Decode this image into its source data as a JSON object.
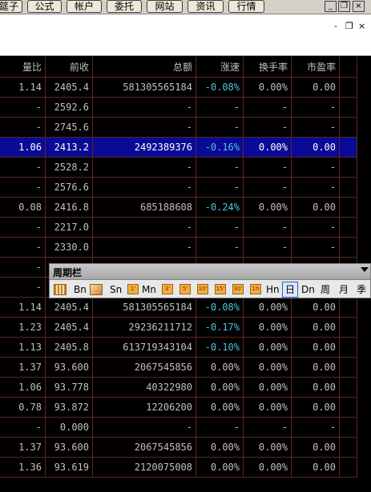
{
  "menubar": {
    "items": [
      "筵子",
      "公式",
      "帐户",
      "委托",
      "网站",
      "资讯",
      "行情"
    ],
    "window_controls": [
      "_",
      "❐",
      "×"
    ]
  },
  "subwindow": {
    "controls": [
      "-",
      "❐",
      "×"
    ]
  },
  "table": {
    "headers": [
      "量比",
      "前收",
      "总额",
      "涨速",
      "换手率",
      "市盈率"
    ],
    "selected_row": 3,
    "rows": [
      [
        "1.14",
        "2405.4",
        "581305565184",
        "-0.08%",
        "0.00%",
        "0.00"
      ],
      [
        "-",
        "2592.6",
        "-",
        "-",
        "-",
        "-"
      ],
      [
        "-",
        "2745.6",
        "-",
        "-",
        "-",
        "-"
      ],
      [
        "1.06",
        "2413.2",
        "2492389376",
        "-0.16%",
        "0.00%",
        "0.00"
      ],
      [
        "-",
        "2528.2",
        "-",
        "-",
        "-",
        "-"
      ],
      [
        "-",
        "2576.6",
        "-",
        "-",
        "-",
        "-"
      ],
      [
        "0.08",
        "2416.8",
        "685188608",
        "-0.24%",
        "0.00%",
        "0.00"
      ],
      [
        "-",
        "2217.0",
        "-",
        "-",
        "-",
        "-"
      ],
      [
        "-",
        "2330.0",
        "-",
        "-",
        "-",
        "-"
      ],
      [
        "-",
        "",
        "",
        "",
        "",
        ""
      ],
      [
        "-",
        "",
        "",
        "",
        "",
        ""
      ],
      [
        "1.14",
        "2405.4",
        "581305565184",
        "-0.08%",
        "0.00%",
        "0.00"
      ],
      [
        "1.23",
        "2405.4",
        "29236211712",
        "-0.17%",
        "0.00%",
        "0.00"
      ],
      [
        "1.13",
        "2405.8",
        "613719343104",
        "-0.10%",
        "0.00%",
        "0.00"
      ],
      [
        "1.37",
        "93.600",
        "2067545856",
        "0.00%",
        "0.00%",
        "0.00"
      ],
      [
        "1.06",
        "93.778",
        "40322980",
        "0.00%",
        "0.00%",
        "0.00"
      ],
      [
        "0.78",
        "93.872",
        "12206200",
        "0.00%",
        "0.00%",
        "0.00"
      ],
      [
        "-",
        "0.000",
        "-",
        "-",
        "-",
        "-"
      ],
      [
        "1.37",
        "93.600",
        "2067545856",
        "0.00%",
        "0.00%",
        "0.00"
      ],
      [
        "1.36",
        "93.619",
        "2120075008",
        "0.00%",
        "0.00%",
        "0.00"
      ]
    ]
  },
  "toolbar": {
    "title": "周期栏",
    "icon_labels": [
      "1'",
      "M'",
      "3'",
      "5'",
      "10'",
      "15'",
      "30'",
      "1h"
    ],
    "labels": {
      "bn": "Bn",
      "sn": "Sn",
      "mn": "Mn",
      "hn": "Hn",
      "day": "日",
      "dn": "Dn",
      "week": "周",
      "month": "月",
      "season": "季"
    }
  },
  "colors": {
    "grid": "#5a2a1a",
    "selected_row": "#0a0a96",
    "negative_speed": "#4fc6d6"
  }
}
